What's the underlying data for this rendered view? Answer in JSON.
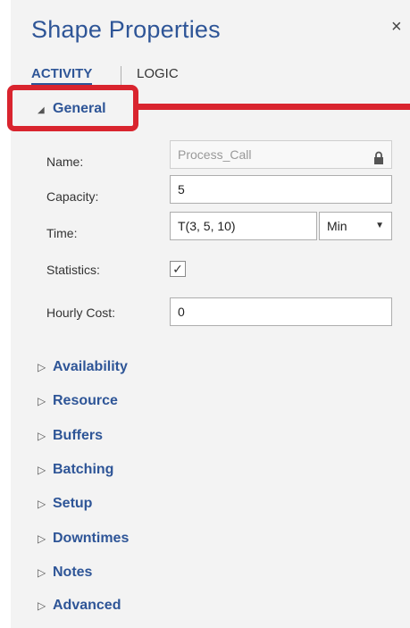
{
  "panel": {
    "title": "Shape Properties",
    "close_glyph": "×"
  },
  "tabs": [
    {
      "label": "ACTIVITY",
      "active": true
    },
    {
      "label": "LOGIC",
      "active": false
    }
  ],
  "general": {
    "label": "General",
    "expanded": true,
    "fields": {
      "name": {
        "label": "Name:",
        "value": "Process_Call",
        "locked": true
      },
      "capacity": {
        "label": "Capacity:",
        "value": "5"
      },
      "time": {
        "label": "Time:",
        "value": "T(3, 5, 10)",
        "unit": "Min"
      },
      "statistics": {
        "label": "Statistics:",
        "checked": true,
        "check_glyph": "✓"
      },
      "hourly_cost": {
        "label": "Hourly Cost:",
        "value": "0"
      }
    }
  },
  "sections": [
    {
      "label": "Availability"
    },
    {
      "label": "Resource"
    },
    {
      "label": "Buffers"
    },
    {
      "label": "Batching"
    },
    {
      "label": "Setup"
    },
    {
      "label": "Downtimes"
    },
    {
      "label": "Notes"
    },
    {
      "label": "Advanced"
    }
  ],
  "icons": {
    "expanded": "◢",
    "collapsed": "▷",
    "lock": "lock-icon",
    "dropdown": "▼"
  },
  "colors": {
    "accent": "#2e5597",
    "highlight": "#d9242e",
    "panel_bg": "#f3f3f3"
  }
}
